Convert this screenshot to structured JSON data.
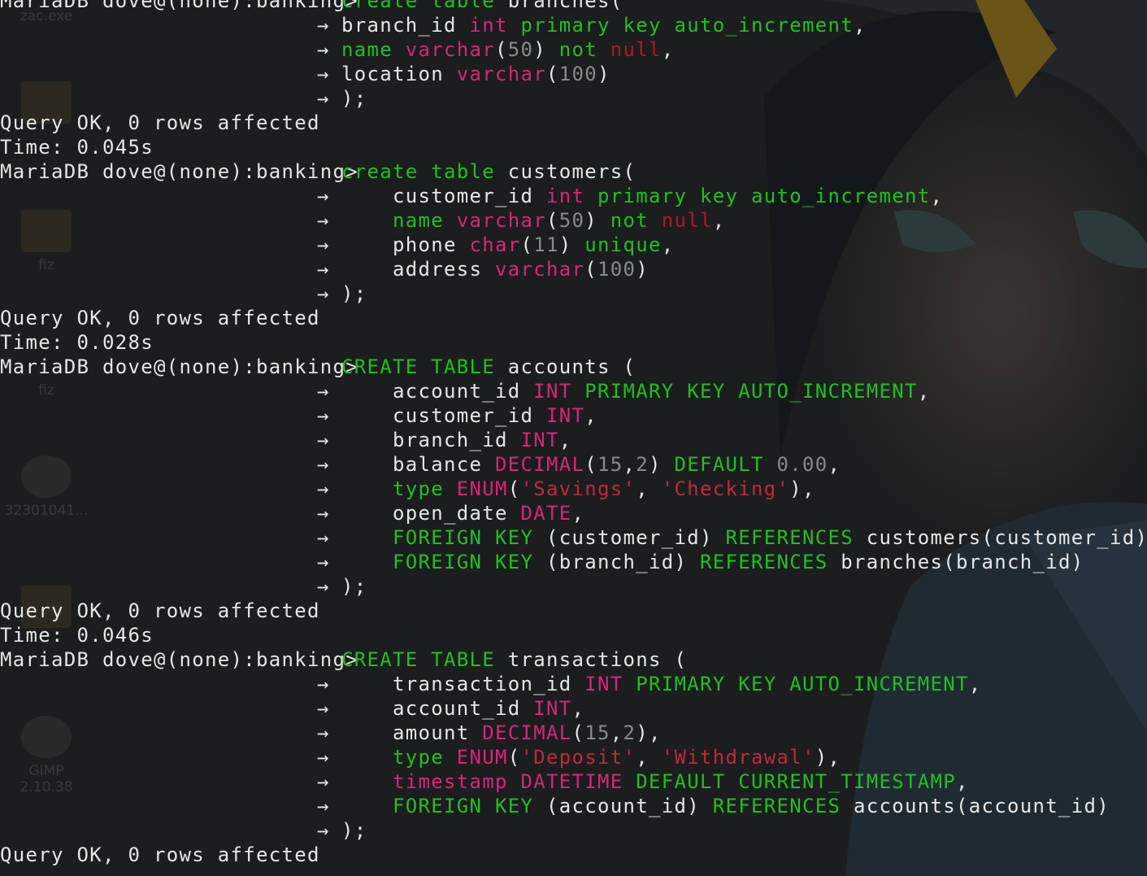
{
  "prompt": "MariaDB dove@(none):banking>",
  "continuation": "→",
  "desktop_icons": [
    "zac.exe",
    "",
    "fiz",
    "fiz",
    "32301041...",
    "",
    "GIMP 2.10.38"
  ],
  "terminal_lines": [
    {
      "kind": "prompt",
      "tokens": [
        {
          "t": "create table ",
          "c": "kw"
        },
        {
          "t": "branches(",
          "c": "pl"
        }
      ]
    },
    {
      "kind": "cont",
      "tokens": [
        {
          "t": "branch_id ",
          "c": "pl"
        },
        {
          "t": "int ",
          "c": "ty"
        },
        {
          "t": "primary key auto_increment",
          "c": "kw"
        },
        {
          "t": ",",
          "c": "pl"
        }
      ]
    },
    {
      "kind": "cont",
      "tokens": [
        {
          "t": "name ",
          "c": "kw"
        },
        {
          "t": "varchar",
          "c": "ty"
        },
        {
          "t": "(",
          "c": "pl"
        },
        {
          "t": "50",
          "c": "nu"
        },
        {
          "t": ") ",
          "c": "pl"
        },
        {
          "t": "not ",
          "c": "kw"
        },
        {
          "t": "null",
          "c": "nl"
        },
        {
          "t": ",",
          "c": "pl"
        }
      ]
    },
    {
      "kind": "cont",
      "tokens": [
        {
          "t": "location ",
          "c": "pl"
        },
        {
          "t": "varchar",
          "c": "ty"
        },
        {
          "t": "(",
          "c": "pl"
        },
        {
          "t": "100",
          "c": "nu"
        },
        {
          "t": ")",
          "c": "pl"
        }
      ]
    },
    {
      "kind": "cont",
      "tokens": [
        {
          "t": ");",
          "c": "pl"
        }
      ]
    },
    {
      "kind": "out",
      "text": "Query OK, 0 rows affected"
    },
    {
      "kind": "out",
      "text": "Time: 0.045s"
    },
    {
      "kind": "prompt",
      "tokens": [
        {
          "t": "create table ",
          "c": "kw"
        },
        {
          "t": "customers(",
          "c": "pl"
        }
      ]
    },
    {
      "kind": "cont",
      "tokens": [
        {
          "t": "    customer_id ",
          "c": "pl"
        },
        {
          "t": "int ",
          "c": "ty"
        },
        {
          "t": "primary key auto_increment",
          "c": "kw"
        },
        {
          "t": ",",
          "c": "pl"
        }
      ]
    },
    {
      "kind": "cont",
      "tokens": [
        {
          "t": "    ",
          "c": "pl"
        },
        {
          "t": "name ",
          "c": "kw"
        },
        {
          "t": "varchar",
          "c": "ty"
        },
        {
          "t": "(",
          "c": "pl"
        },
        {
          "t": "50",
          "c": "nu"
        },
        {
          "t": ") ",
          "c": "pl"
        },
        {
          "t": "not ",
          "c": "kw"
        },
        {
          "t": "null",
          "c": "nl"
        },
        {
          "t": ",",
          "c": "pl"
        }
      ]
    },
    {
      "kind": "cont",
      "tokens": [
        {
          "t": "    phone ",
          "c": "pl"
        },
        {
          "t": "char",
          "c": "ty"
        },
        {
          "t": "(",
          "c": "pl"
        },
        {
          "t": "11",
          "c": "nu"
        },
        {
          "t": ") ",
          "c": "pl"
        },
        {
          "t": "unique",
          "c": "kw"
        },
        {
          "t": ",",
          "c": "pl"
        }
      ]
    },
    {
      "kind": "cont",
      "tokens": [
        {
          "t": "    address ",
          "c": "pl"
        },
        {
          "t": "varchar",
          "c": "ty"
        },
        {
          "t": "(",
          "c": "pl"
        },
        {
          "t": "100",
          "c": "nu"
        },
        {
          "t": ")",
          "c": "pl"
        }
      ]
    },
    {
      "kind": "cont",
      "tokens": [
        {
          "t": ");",
          "c": "pl"
        }
      ]
    },
    {
      "kind": "out",
      "text": "Query OK, 0 rows affected"
    },
    {
      "kind": "out",
      "text": "Time: 0.028s"
    },
    {
      "kind": "prompt",
      "tokens": [
        {
          "t": "CREATE TABLE ",
          "c": "kw"
        },
        {
          "t": "accounts (",
          "c": "pl"
        }
      ]
    },
    {
      "kind": "cont",
      "tokens": [
        {
          "t": "    account_id ",
          "c": "pl"
        },
        {
          "t": "INT ",
          "c": "ty"
        },
        {
          "t": "PRIMARY KEY AUTO_INCREMENT",
          "c": "kw"
        },
        {
          "t": ",",
          "c": "pl"
        }
      ]
    },
    {
      "kind": "cont",
      "tokens": [
        {
          "t": "    customer_id ",
          "c": "pl"
        },
        {
          "t": "INT",
          "c": "ty"
        },
        {
          "t": ",",
          "c": "pl"
        }
      ]
    },
    {
      "kind": "cont",
      "tokens": [
        {
          "t": "    branch_id ",
          "c": "pl"
        },
        {
          "t": "INT",
          "c": "ty"
        },
        {
          "t": ",",
          "c": "pl"
        }
      ]
    },
    {
      "kind": "cont",
      "tokens": [
        {
          "t": "    balance ",
          "c": "pl"
        },
        {
          "t": "DECIMAL",
          "c": "ty"
        },
        {
          "t": "(",
          "c": "pl"
        },
        {
          "t": "15",
          "c": "nu"
        },
        {
          "t": ",",
          "c": "pl"
        },
        {
          "t": "2",
          "c": "nu"
        },
        {
          "t": ") ",
          "c": "pl"
        },
        {
          "t": "DEFAULT ",
          "c": "kw"
        },
        {
          "t": "0.00",
          "c": "nu"
        },
        {
          "t": ",",
          "c": "pl"
        }
      ]
    },
    {
      "kind": "cont",
      "tokens": [
        {
          "t": "    ",
          "c": "pl"
        },
        {
          "t": "type ",
          "c": "kw"
        },
        {
          "t": "ENUM",
          "c": "ty"
        },
        {
          "t": "(",
          "c": "pl"
        },
        {
          "t": "'Savings'",
          "c": "st"
        },
        {
          "t": ", ",
          "c": "pl"
        },
        {
          "t": "'Checking'",
          "c": "st"
        },
        {
          "t": "),",
          "c": "pl"
        }
      ]
    },
    {
      "kind": "cont",
      "tokens": [
        {
          "t": "    open_date ",
          "c": "pl"
        },
        {
          "t": "DATE",
          "c": "ty"
        },
        {
          "t": ",",
          "c": "pl"
        }
      ]
    },
    {
      "kind": "cont",
      "tokens": [
        {
          "t": "    ",
          "c": "pl"
        },
        {
          "t": "FOREIGN KEY ",
          "c": "kw"
        },
        {
          "t": "(customer_id) ",
          "c": "pl"
        },
        {
          "t": "REFERENCES ",
          "c": "kw"
        },
        {
          "t": "customers(customer_id),",
          "c": "pl"
        }
      ]
    },
    {
      "kind": "cont",
      "tokens": [
        {
          "t": "    ",
          "c": "pl"
        },
        {
          "t": "FOREIGN KEY ",
          "c": "kw"
        },
        {
          "t": "(branch_id) ",
          "c": "pl"
        },
        {
          "t": "REFERENCES ",
          "c": "kw"
        },
        {
          "t": "branches(branch_id)",
          "c": "pl"
        }
      ]
    },
    {
      "kind": "cont",
      "tokens": [
        {
          "t": ");",
          "c": "pl"
        }
      ]
    },
    {
      "kind": "out",
      "text": "Query OK, 0 rows affected"
    },
    {
      "kind": "out",
      "text": "Time: 0.046s"
    },
    {
      "kind": "prompt",
      "tokens": [
        {
          "t": "CREATE TABLE ",
          "c": "kw"
        },
        {
          "t": "transactions (",
          "c": "pl"
        }
      ]
    },
    {
      "kind": "cont",
      "tokens": [
        {
          "t": "    transaction_id ",
          "c": "pl"
        },
        {
          "t": "INT ",
          "c": "ty"
        },
        {
          "t": "PRIMARY KEY AUTO_INCREMENT",
          "c": "kw"
        },
        {
          "t": ",",
          "c": "pl"
        }
      ]
    },
    {
      "kind": "cont",
      "tokens": [
        {
          "t": "    account_id ",
          "c": "pl"
        },
        {
          "t": "INT",
          "c": "ty"
        },
        {
          "t": ",",
          "c": "pl"
        }
      ]
    },
    {
      "kind": "cont",
      "tokens": [
        {
          "t": "    amount ",
          "c": "pl"
        },
        {
          "t": "DECIMAL",
          "c": "ty"
        },
        {
          "t": "(",
          "c": "pl"
        },
        {
          "t": "15",
          "c": "nu"
        },
        {
          "t": ",",
          "c": "pl"
        },
        {
          "t": "2",
          "c": "nu"
        },
        {
          "t": "),",
          "c": "pl"
        }
      ]
    },
    {
      "kind": "cont",
      "tokens": [
        {
          "t": "    ",
          "c": "pl"
        },
        {
          "t": "type ",
          "c": "kw"
        },
        {
          "t": "ENUM",
          "c": "ty"
        },
        {
          "t": "(",
          "c": "pl"
        },
        {
          "t": "'Deposit'",
          "c": "st"
        },
        {
          "t": ", ",
          "c": "pl"
        },
        {
          "t": "'Withdrawal'",
          "c": "st"
        },
        {
          "t": "),",
          "c": "pl"
        }
      ]
    },
    {
      "kind": "cont",
      "tokens": [
        {
          "t": "    ",
          "c": "pl"
        },
        {
          "t": "timestamp ",
          "c": "ty"
        },
        {
          "t": "DATETIME ",
          "c": "ty"
        },
        {
          "t": "DEFAULT CURRENT_TIMESTAMP",
          "c": "kw"
        },
        {
          "t": ",",
          "c": "pl"
        }
      ]
    },
    {
      "kind": "cont",
      "tokens": [
        {
          "t": "    ",
          "c": "pl"
        },
        {
          "t": "FOREIGN KEY ",
          "c": "kw"
        },
        {
          "t": "(account_id) ",
          "c": "pl"
        },
        {
          "t": "REFERENCES ",
          "c": "kw"
        },
        {
          "t": "accounts(account_id)",
          "c": "pl"
        }
      ]
    },
    {
      "kind": "cont",
      "tokens": [
        {
          "t": ");",
          "c": "pl"
        }
      ]
    },
    {
      "kind": "out",
      "text": "Query OK, 0 rows affected"
    }
  ],
  "colors": {
    "background": "#1b1d1e",
    "plain_text": "#e6e6e6",
    "keyword": "#20c020",
    "type": "#d6267a",
    "number": "#8a8a8a",
    "string": "#c02a3a"
  }
}
